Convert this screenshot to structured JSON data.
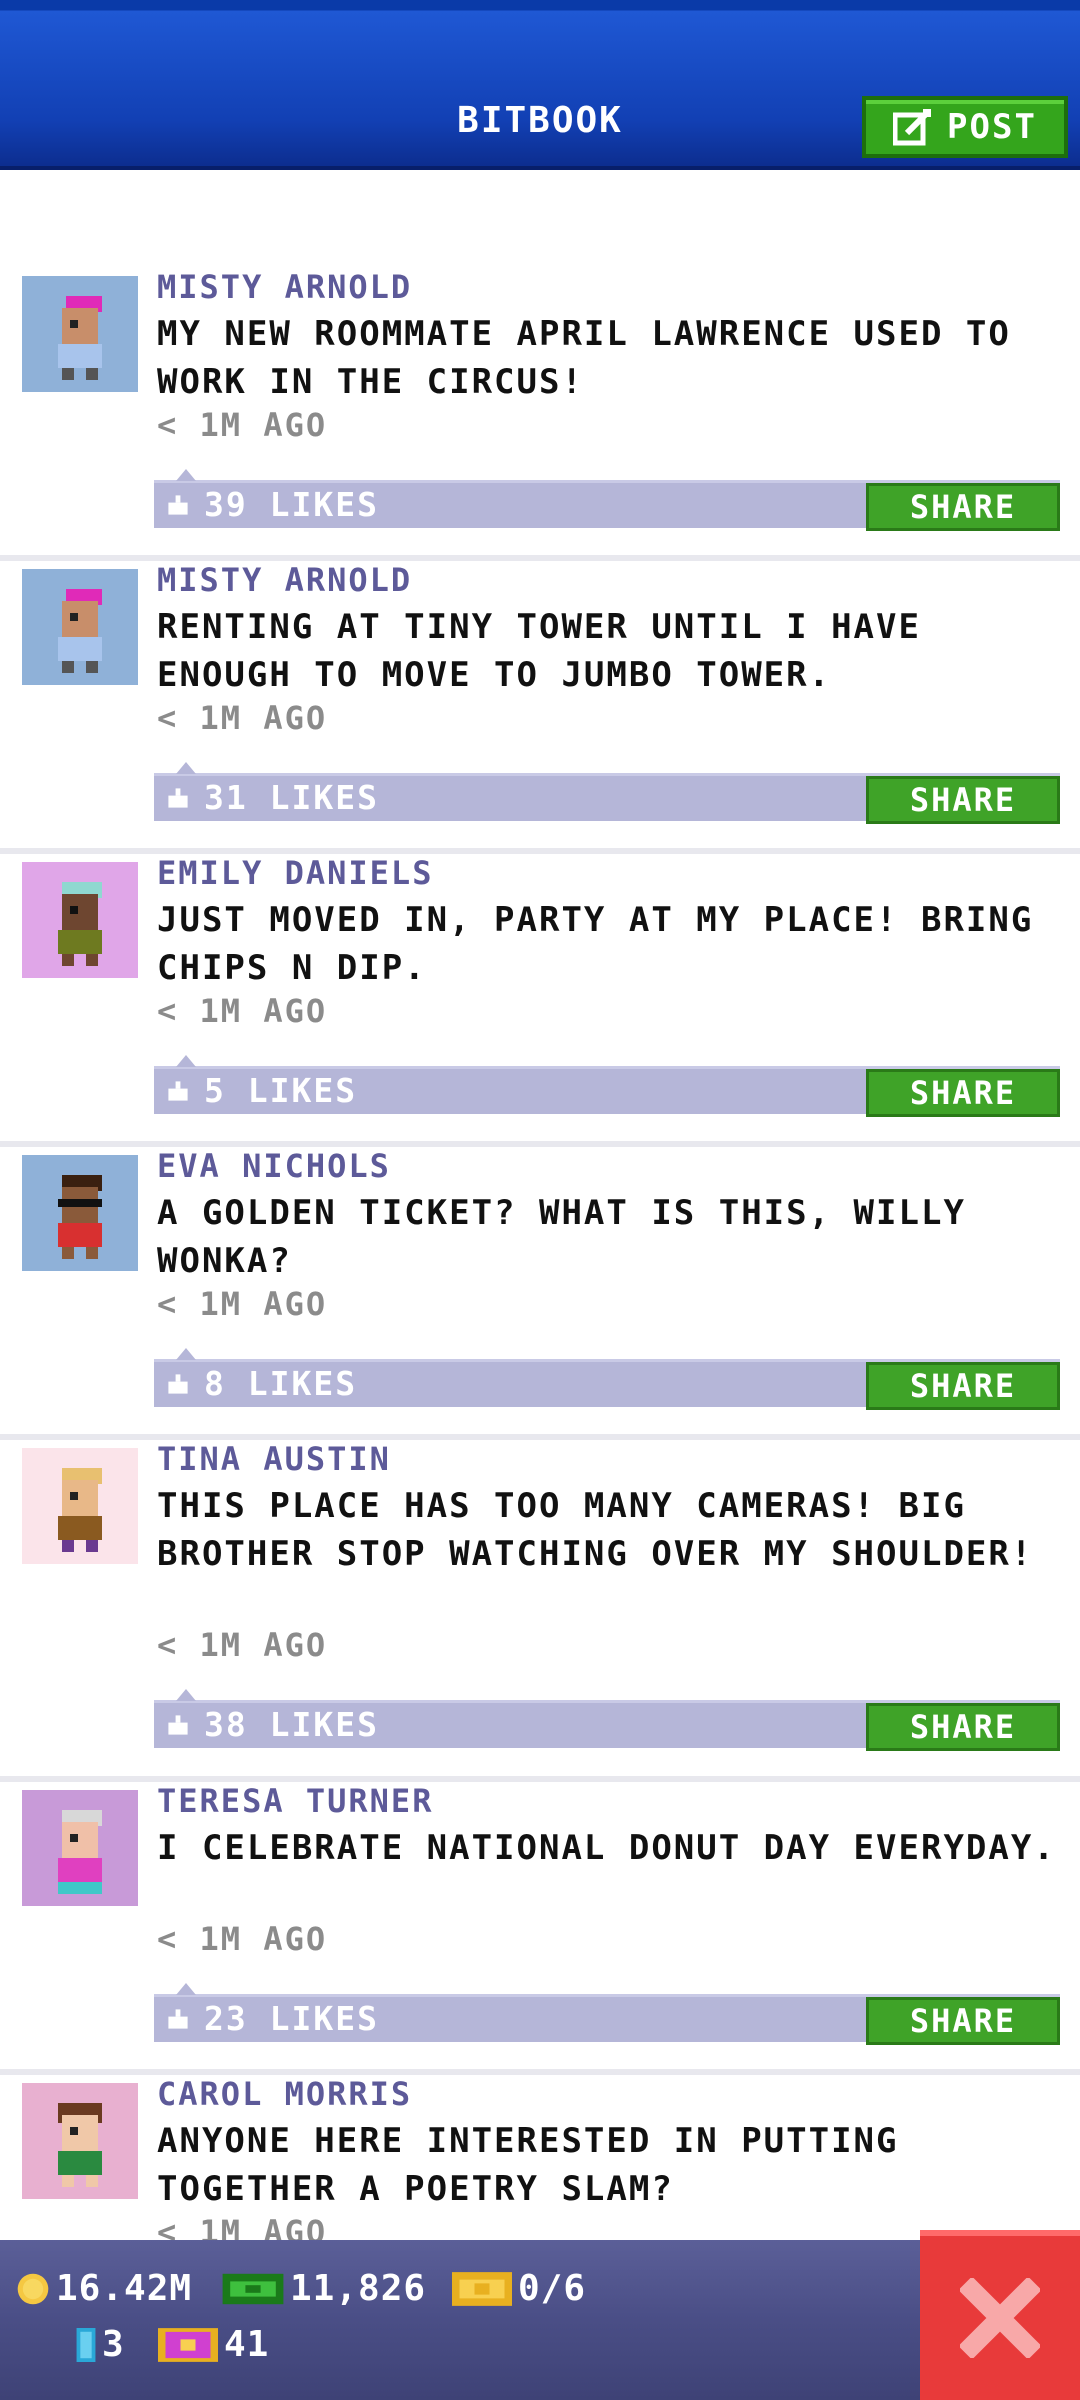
{
  "header": {
    "title": "BITBOOK",
    "post_label": "POST"
  },
  "posts": [
    {
      "name": "MISTY ARNOLD",
      "message": "MY NEW ROOMMATE APRIL LAWRENCE USED TO WORK IN THE CIRCUS!",
      "time": "< 1M AGO",
      "likes": "39 LIKES",
      "share": "SHARE"
    },
    {
      "name": "MISTY ARNOLD",
      "message": "RENTING AT TINY TOWER UNTIL I HAVE ENOUGH TO MOVE TO JUMBO TOWER.",
      "time": "< 1M AGO",
      "likes": "31 LIKES",
      "share": "SHARE"
    },
    {
      "name": "EMILY DANIELS",
      "message": "JUST MOVED IN, PARTY AT MY PLACE! BRING CHIPS N DIP.",
      "time": "< 1M AGO",
      "likes": "5 LIKES",
      "share": "SHARE"
    },
    {
      "name": "EVA NICHOLS",
      "message": "A GOLDEN TICKET? WHAT IS THIS, WILLY WONKA?",
      "time": "< 1M AGO",
      "likes": "8 LIKES",
      "share": "SHARE"
    },
    {
      "name": "TINA AUSTIN",
      "message": "THIS PLACE HAS TOO MANY CAMERAS! BIG BROTHER STOP WATCHING OVER MY SHOULDER!",
      "time": "< 1M AGO",
      "likes": "38 LIKES",
      "share": "SHARE"
    },
    {
      "name": "TERESA TURNER",
      "message": "I CELEBRATE NATIONAL DONUT DAY EVERYDAY.",
      "time": "< 1M AGO",
      "likes": "23 LIKES",
      "share": "SHARE"
    },
    {
      "name": "CAROL MORRIS",
      "message": "ANYONE HERE INTERESTED IN PUTTING TOGETHER A POETRY SLAM?",
      "time": "< 1M AGO",
      "likes": "",
      "share": ""
    }
  ],
  "resources": {
    "coins": "16.42M",
    "bux": "11,826",
    "tickets": "0/6",
    "elevator": "3",
    "gems": "41"
  },
  "colors": {
    "header_blue": "#1240b4",
    "post_green": "#34a51c",
    "likes_bar": "#b5b6d8",
    "name_purple": "#5d5a99",
    "close_red": "#e83a3a"
  }
}
